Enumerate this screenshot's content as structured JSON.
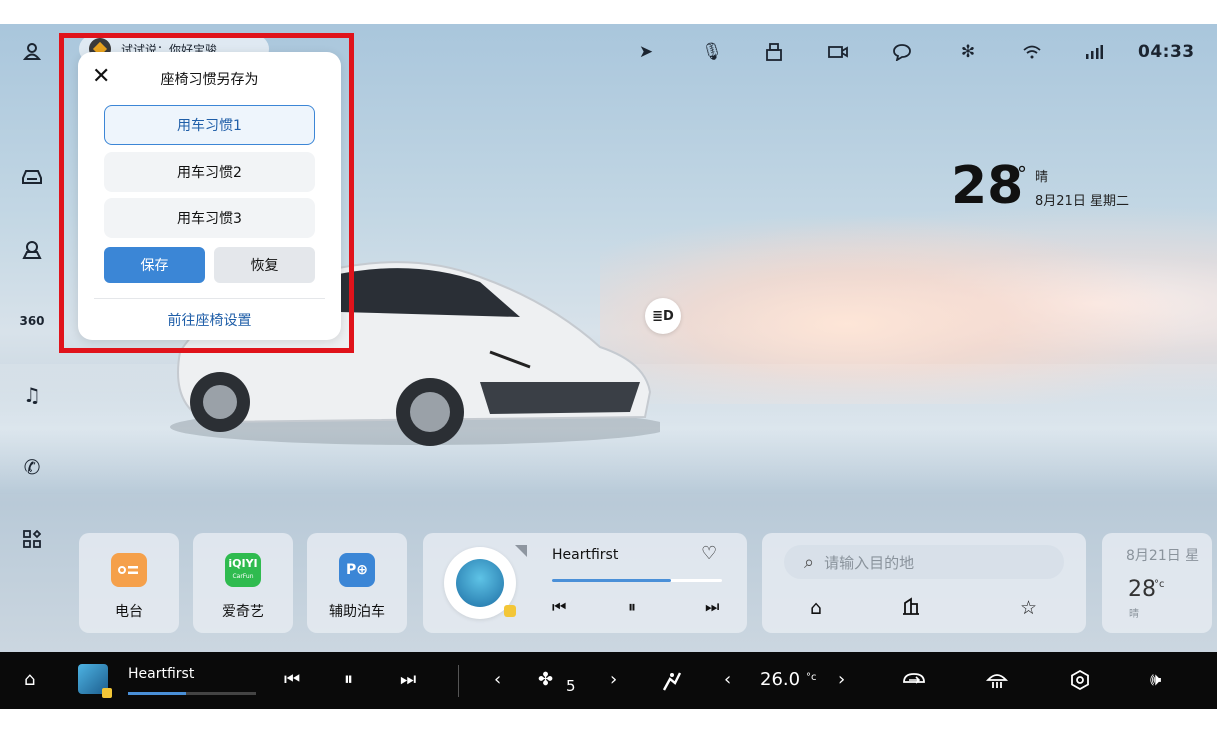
{
  "voice": {
    "hint": "试试说：你好宝骏"
  },
  "status": {
    "time": "04:33"
  },
  "weather": {
    "temp": "28",
    "degree_symbol": "°",
    "condition": "晴",
    "date": "8月21日 星期二"
  },
  "headlight_label": "≣D",
  "popup": {
    "title": "座椅习惯另存为",
    "options": [
      "用车习惯1",
      "用车习惯2",
      "用车习惯3"
    ],
    "selected_index": 0,
    "save_label": "保存",
    "restore_label": "恢复",
    "link_label": "前往座椅设置"
  },
  "apps": [
    {
      "label": "电台",
      "icon": "radio-icon",
      "color": "#f5a04a"
    },
    {
      "label": "爱奇艺",
      "icon": "iqiyi-icon",
      "color": "#2fbb4f",
      "icon_text": "iQIYI",
      "icon_subtext": "CarFun"
    },
    {
      "label": "辅助泊车",
      "icon": "parking-icon",
      "color": "#3b86d6",
      "icon_text": "P⊕"
    }
  ],
  "music": {
    "song": "Heartfirst",
    "progress": 0.7
  },
  "navigation": {
    "search_placeholder": "请输入目的地"
  },
  "weather_card": {
    "date": "8月21日 星",
    "temp": "28",
    "unit": "°c",
    "condition": "晴"
  },
  "dock": {
    "song": "Heartfirst",
    "progress": 0.45,
    "fan_level": "5",
    "temperature": "26.0",
    "temperature_unit": "°c"
  },
  "colors": {
    "accent": "#3b86d6",
    "highlight_outline": "#e0131b"
  }
}
